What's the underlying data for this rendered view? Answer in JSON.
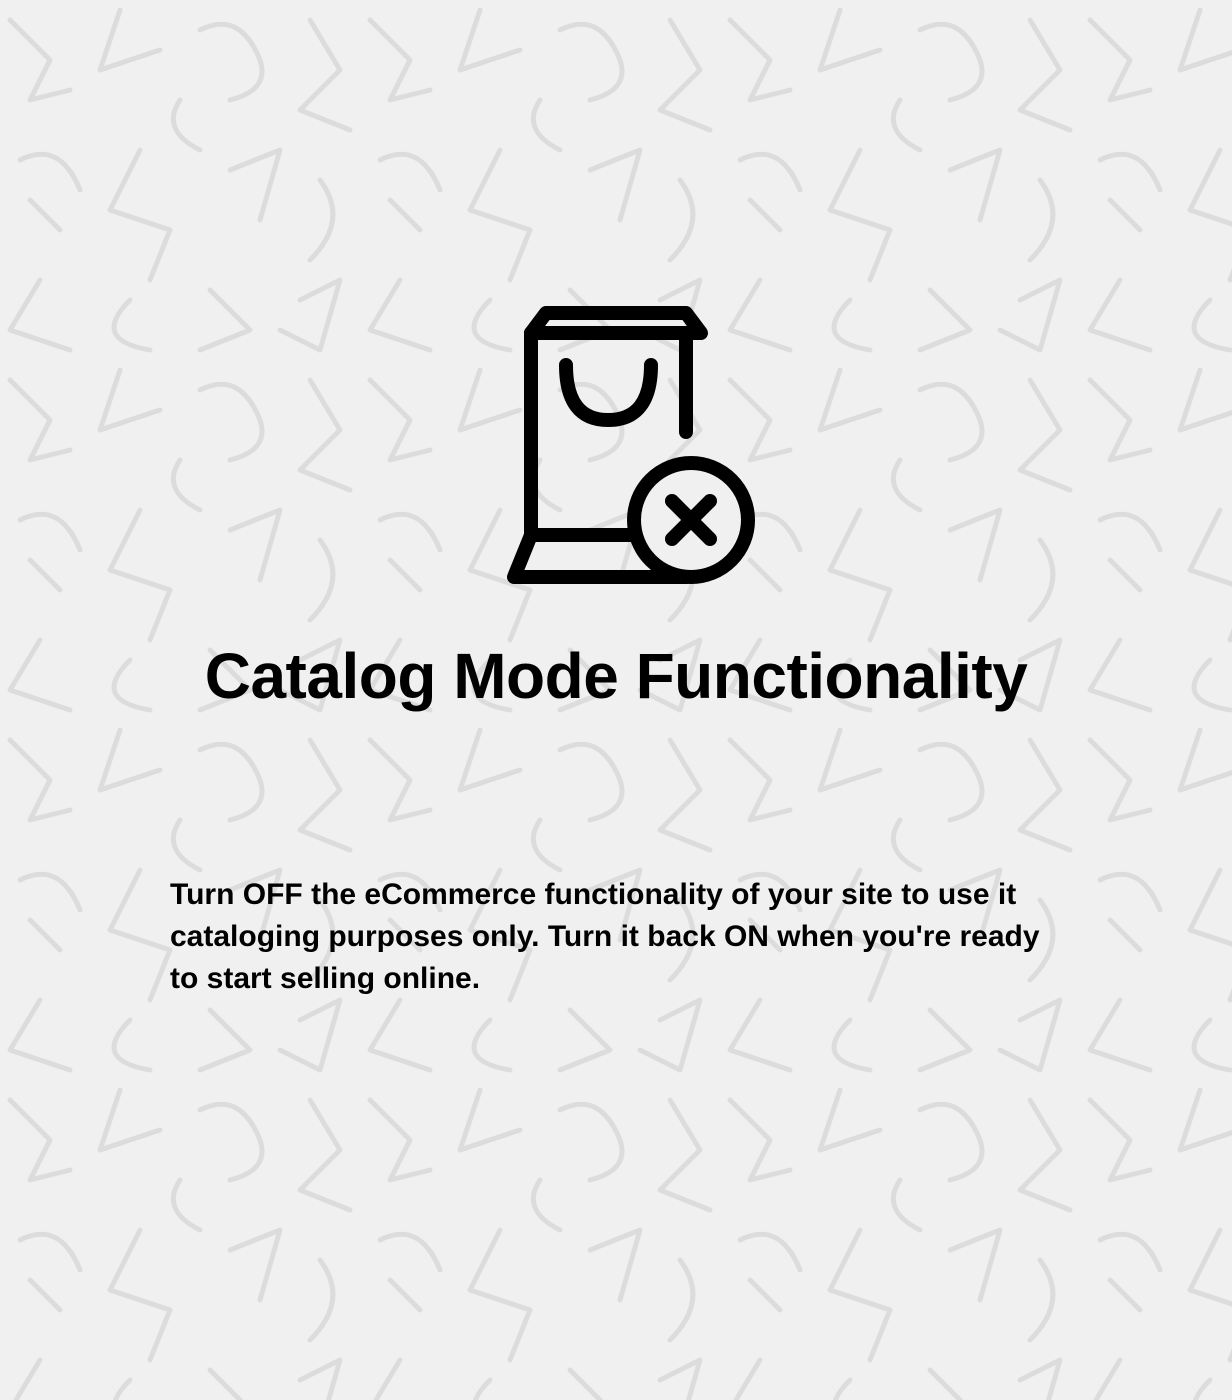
{
  "title": "Catalog Mode Functionality",
  "description": "Turn OFF the eCommerce functionality of your site to use it cataloging purposes only. Turn it back ON when you're ready to start selling online.",
  "icon": "shopping-bag-x"
}
